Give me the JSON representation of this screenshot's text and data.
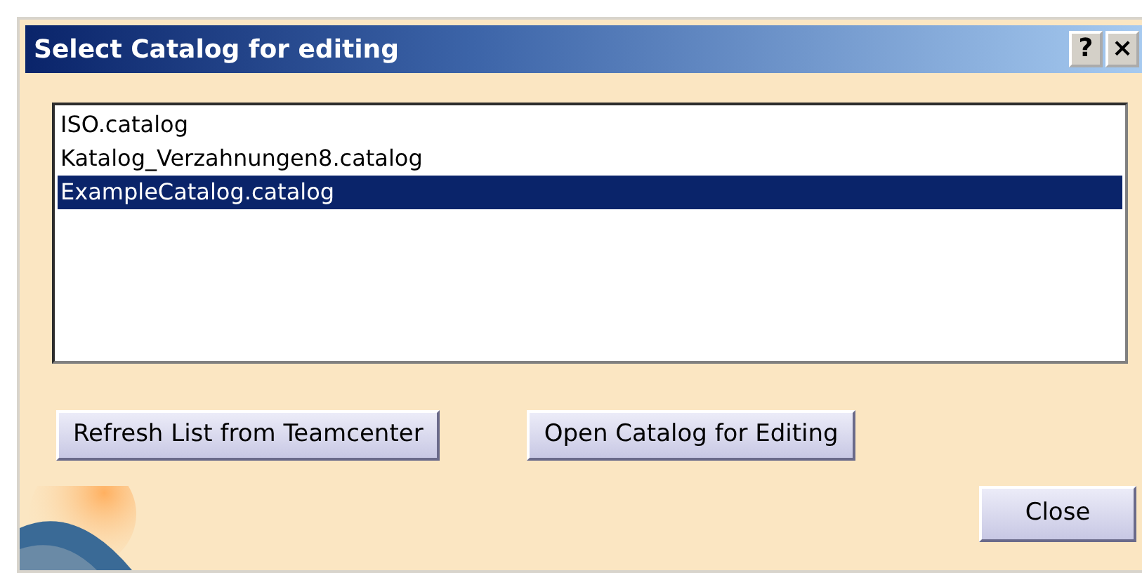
{
  "window": {
    "title": "Select Catalog for editing",
    "title_buttons": [
      "?",
      "×"
    ]
  },
  "catalogs": [
    {
      "label": "ISO.catalog",
      "selected": false
    },
    {
      "label": "Katalog_Verzahnungen8.catalog",
      "selected": false
    },
    {
      "label": "ExampleCatalog.catalog",
      "selected": true
    }
  ],
  "buttons": [
    "Refresh List from Teamcenter",
    "Open Catalog for Editing"
  ],
  "close_button": "Close"
}
